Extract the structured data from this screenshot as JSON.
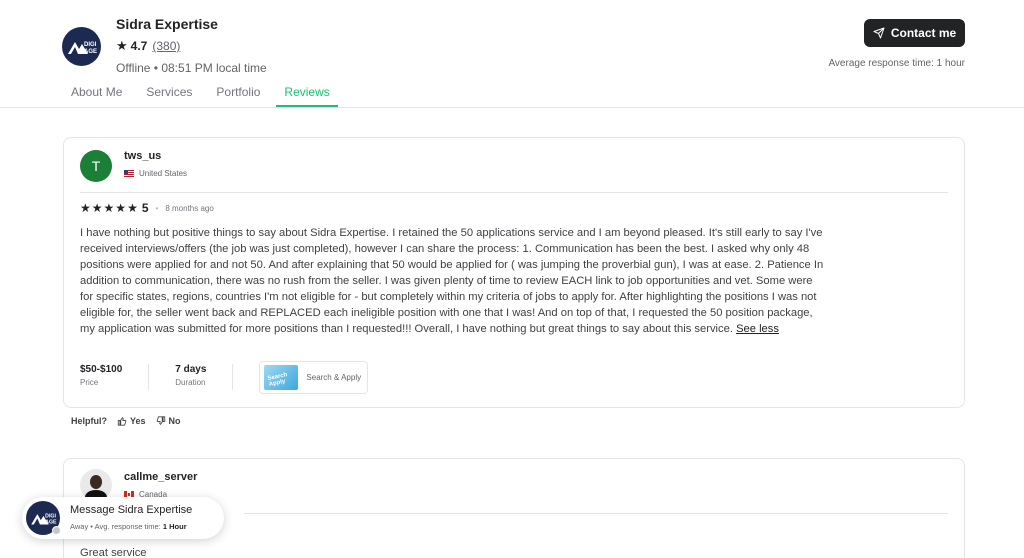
{
  "seller": {
    "name": "Sidra Expertise",
    "rating": "4.7",
    "review_count": "(380)",
    "status": "Offline • 08:51 PM local time",
    "logo_text_top": "DIGI",
    "logo_text_bottom": "AGE",
    "contact_label": "Contact me",
    "avg_response": "Average response time: 1 hour"
  },
  "tabs": [
    {
      "label": "About Me",
      "active": false
    },
    {
      "label": "Services",
      "active": false
    },
    {
      "label": "Portfolio",
      "active": false
    },
    {
      "label": "Reviews",
      "active": true
    }
  ],
  "reviews": [
    {
      "avatar_letter": "T",
      "username": "tws_us",
      "country": "United States",
      "rating": "5",
      "time_ago": "8 months ago",
      "text": "I have nothing but positive things to say about Sidra Expertise. I retained the 50 applications service and I am beyond pleased. It's still early to say I've received interviews/offers (the job was just completed), however I can share the process: 1. Communication has been the best. I asked why only 48 positions were applied for and not 50. And after explaining that 50 would be applied for ( was jumping the proverbial gun), I was at ease. 2. Patience In addition to communication, there was no rush from the seller. I was given plenty of time to review EACH link to job opportunities and vet. Some were for specific states, regions, countries I'm not eligible for - but completely within my criteria of jobs to apply for. After highlighting the positions I was not eligible for, the seller went back and REPLACED each ineligible position with one that I was! And on top of that, I requested the 50 position package, my application was submitted for more positions than I requested!!! Overall, I have nothing but great things to say about this service.",
      "see_less": "See less",
      "price_value": "$50-$100",
      "price_label": "Price",
      "duration_value": "7 days",
      "duration_label": "Duration",
      "gig_thumb_text": "Search Apply",
      "gig_label": "Search & Apply"
    },
    {
      "username": "callme_server",
      "country": "Canada",
      "text": "Great service"
    }
  ],
  "helpful": {
    "label": "Helpful?",
    "yes": "Yes",
    "no": "No"
  },
  "message_popup": {
    "title": "Message Sidra Expertise",
    "status": "Away",
    "sep": " • ",
    "resp_label": "Avg. response time:",
    "resp_value": "1 Hour"
  },
  "colors": {
    "accent": "#1dbf73",
    "dark_button": "#222325",
    "avatar_green": "#1a7f37",
    "logo_navy": "#1c2951"
  },
  "icons": [
    "star-icon",
    "paper-plane-icon",
    "thumbs-up-icon",
    "thumbs-down-icon",
    "us-flag-icon",
    "canada-flag-icon"
  ]
}
